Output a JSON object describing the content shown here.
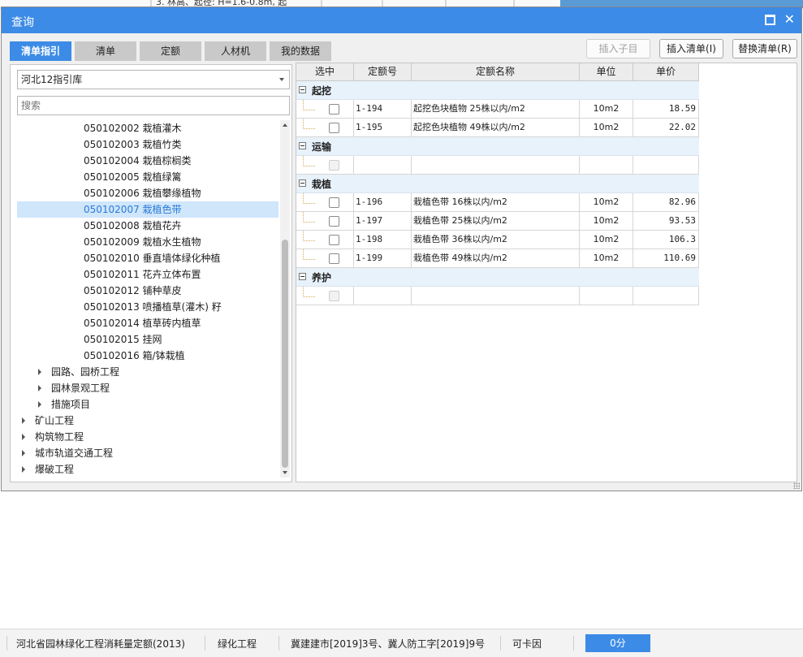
{
  "background": {
    "row_text": "3. 林高、起径: H=1.6-0.8m, 起"
  },
  "dialog": {
    "title": "查询",
    "tabs": [
      "清单指引",
      "清单",
      "定额",
      "人材机",
      "我的数据"
    ],
    "active_tab": "清单指引",
    "buttons": {
      "insert_child": "插入子目",
      "insert_list": "插入清单(I)",
      "replace_list": "替换清单(R)"
    },
    "library": "河北12指引库",
    "search_placeholder": "搜索",
    "tree": [
      {
        "label": "050102002  栽植灌木"
      },
      {
        "label": "050102003  栽植竹类"
      },
      {
        "label": "050102004  栽植棕榈类"
      },
      {
        "label": "050102005  栽植绿篱"
      },
      {
        "label": "050102006  栽植攀缘植物"
      },
      {
        "label": "050102007  栽植色带"
      },
      {
        "label": "050102008  栽植花卉"
      },
      {
        "label": "050102009  栽植水生植物"
      },
      {
        "label": "050102010  垂直墙体绿化种植"
      },
      {
        "label": "050102011  花卉立体布置"
      },
      {
        "label": "050102012  铺种草皮"
      },
      {
        "label": "050102013  喷播植草(灌木) 籽"
      },
      {
        "label": "050102014  植草砖内植草"
      },
      {
        "label": "050102015  挂网"
      },
      {
        "label": "050102016  箱/钵栽植"
      },
      {
        "label": "园路、园桥工程"
      },
      {
        "label": "园林景观工程"
      },
      {
        "label": "措施项目"
      },
      {
        "label": "矿山工程"
      },
      {
        "label": "构筑物工程"
      },
      {
        "label": "城市轨道交通工程"
      },
      {
        "label": "爆破工程"
      }
    ],
    "selected_item": "050102007  栽植色带",
    "table": {
      "headers": [
        "选中",
        "定额号",
        "定额名称",
        "单位",
        "单价"
      ],
      "groups": [
        {
          "name": "起挖",
          "rows": [
            {
              "code": "1-194",
              "name": "起挖色块植物 25株以内/m2",
              "unit": "10m2",
              "price": "18.59"
            },
            {
              "code": "1-195",
              "name": "起挖色块植物 49株以内/m2",
              "unit": "10m2",
              "price": "22.02"
            }
          ]
        },
        {
          "name": "运输",
          "rows": [
            {
              "code": "",
              "name": "",
              "unit": "",
              "price": ""
            }
          ]
        },
        {
          "name": "栽植",
          "rows": [
            {
              "code": "1-196",
              "name": "栽植色带 16株以内/m2",
              "unit": "10m2",
              "price": "82.96"
            },
            {
              "code": "1-197",
              "name": "栽植色带 25株以内/m2",
              "unit": "10m2",
              "price": "93.53"
            },
            {
              "code": "1-198",
              "name": "栽植色带 36株以内/m2",
              "unit": "10m2",
              "price": "106.3"
            },
            {
              "code": "1-199",
              "name": "栽植色带 49株以内/m2",
              "unit": "10m2",
              "price": "110.69"
            }
          ]
        },
        {
          "name": "养护",
          "rows": [
            {
              "code": "",
              "name": "",
              "unit": "",
              "price": ""
            }
          ]
        }
      ]
    }
  },
  "statusbar": {
    "norm": "河北省园林绿化工程消耗量定额(2013)",
    "category": "绿化工程",
    "documents": "冀建建市[2019]3号、冀人防工字[2019]9号",
    "item": "可卡因",
    "score": "0分"
  },
  "colors": {
    "accent": "#3c8be6",
    "selection": "#cfe6fb",
    "group_row": "#e8f2fb"
  }
}
